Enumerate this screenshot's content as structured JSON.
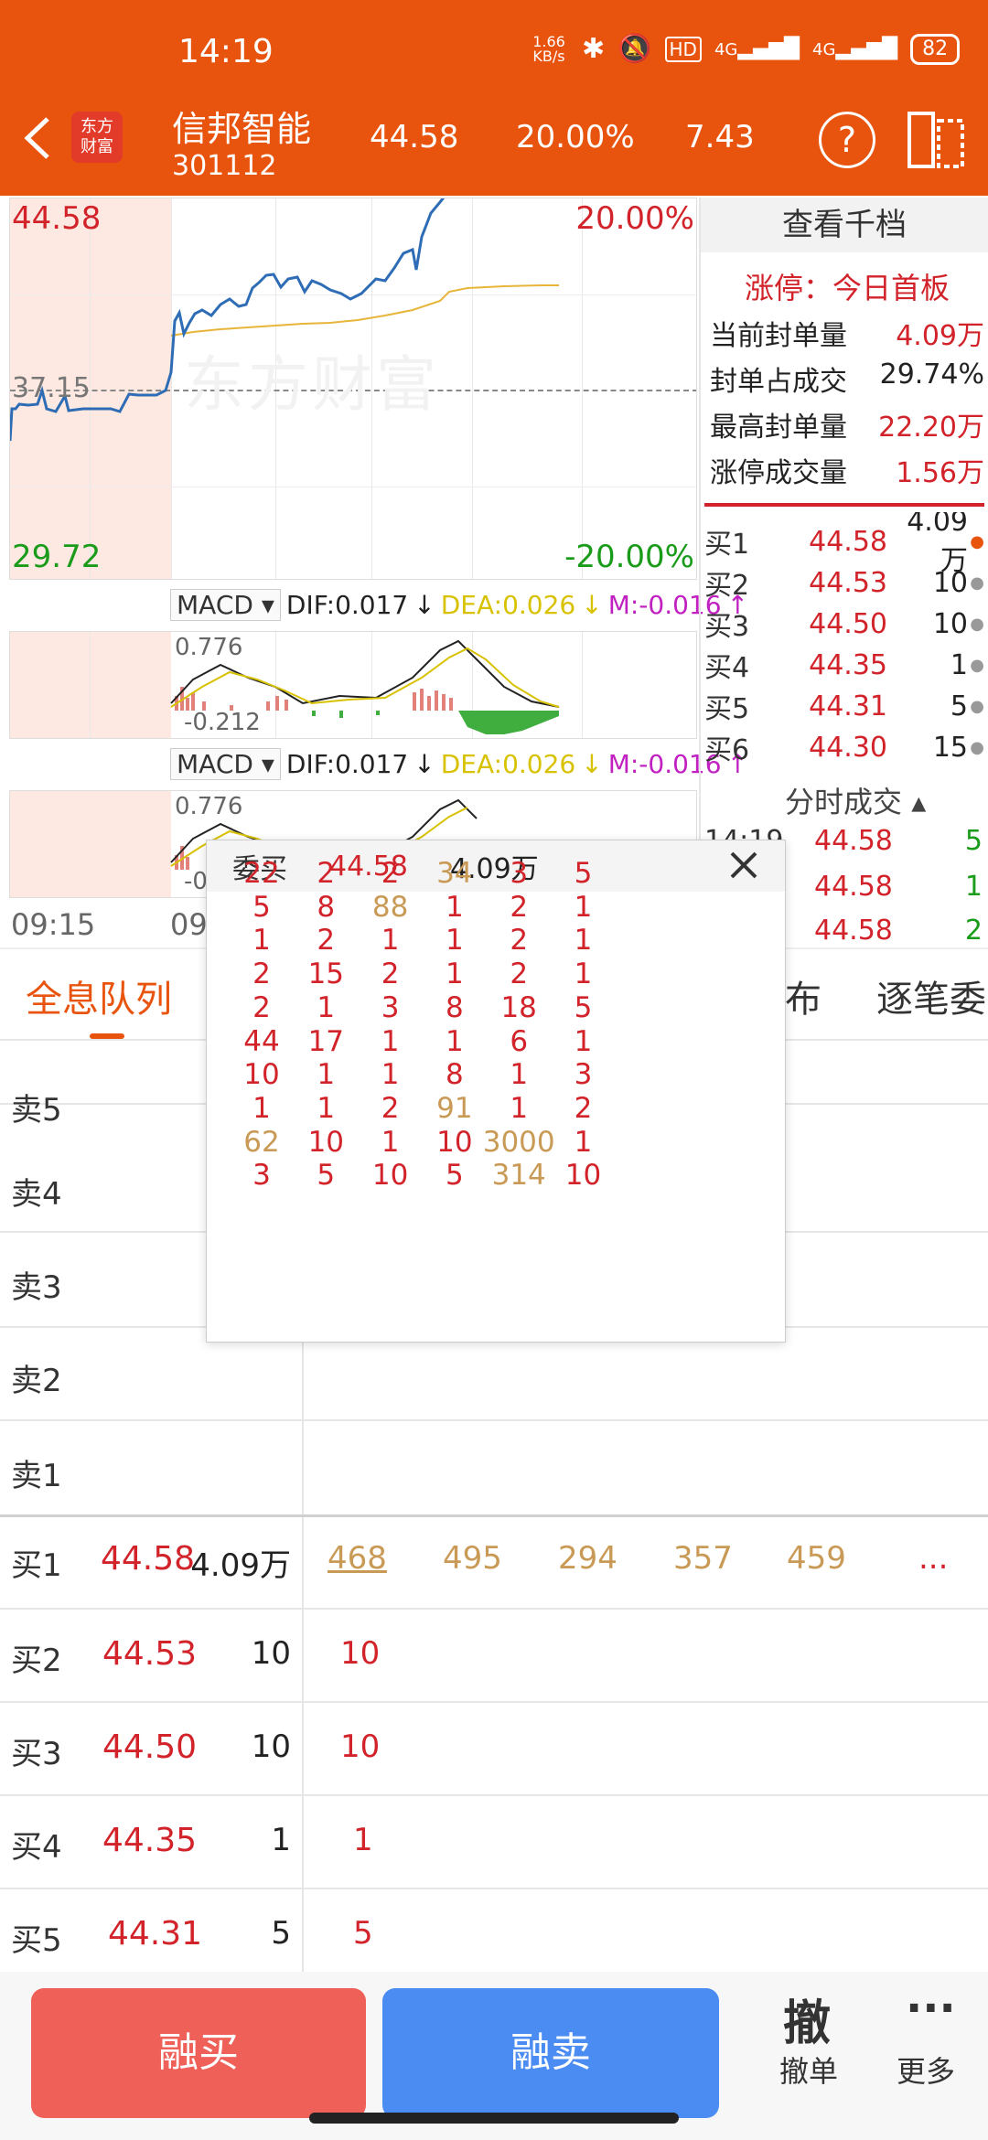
{
  "status": {
    "time": "14:19",
    "net_speed": "1.66 KB/s",
    "hd": "HD",
    "sig1": "4G",
    "sig2": "4G",
    "battery": "82"
  },
  "header": {
    "logo_text": "东方财富",
    "name": "信邦智能",
    "code": "301112",
    "price": "44.58",
    "pct": "20.00%",
    "amount": "7.43"
  },
  "chart": {
    "high_price": "44.58",
    "high_pct": "20.00%",
    "low_price": "29.72",
    "low_pct": "-20.00%",
    "base_price": "37.15",
    "time_start": "09:15",
    "time_mid": "09",
    "watermark": "东方财富",
    "colors": {
      "price_line": "#2E6DB5",
      "avg_line": "#E7B53A",
      "up": "#D2232A",
      "down": "#1A9B1A"
    }
  },
  "macd": [
    {
      "name": "MACD",
      "dif": "DIF:0.017",
      "dea": "DEA:0.026",
      "m": "M:-0.016",
      "top": "0.776",
      "bottom": "-0.212"
    },
    {
      "name": "MACD",
      "dif": "DIF:0.017",
      "dea": "DEA:0.026",
      "m": "M:-0.016",
      "top": "0.776",
      "bottom": "-0"
    }
  ],
  "right_panel": {
    "title": "查看千档",
    "limit_status": "涨停：今日首板",
    "stats": [
      {
        "label": "当前封单量",
        "value": "4.09万"
      },
      {
        "label": "封单占成交",
        "value": "29.74%"
      },
      {
        "label": "最高封单量",
        "value": "22.20万"
      },
      {
        "label": "涨停成交量",
        "value": "1.56万"
      }
    ],
    "orderbook": [
      {
        "label": "买1",
        "price": "44.58",
        "vol": "4.09万"
      },
      {
        "label": "买2",
        "price": "44.53",
        "vol": "10"
      },
      {
        "label": "买3",
        "price": "44.50",
        "vol": "10"
      },
      {
        "label": "买4",
        "price": "44.35",
        "vol": "1"
      },
      {
        "label": "买5",
        "price": "44.31",
        "vol": "5"
      },
      {
        "label": "买6",
        "price": "44.30",
        "vol": "15"
      }
    ],
    "trades_title": "分时成交",
    "trades": [
      {
        "time": "14:19",
        "price": "44.58",
        "vol": "5"
      },
      {
        "time": "",
        "price": "44.58",
        "vol": "1"
      },
      {
        "time": "",
        "price": "44.58",
        "vol": "2"
      }
    ]
  },
  "popup": {
    "label": "委买",
    "price": "44.58",
    "vol": "4.09万",
    "rows": [
      [
        "22",
        "2",
        "2",
        "34",
        "3",
        "5"
      ],
      [
        "5",
        "8",
        "88",
        "1",
        "2",
        "1"
      ],
      [
        "1",
        "2",
        "1",
        "1",
        "2",
        "1"
      ],
      [
        "2",
        "15",
        "2",
        "1",
        "2",
        "1"
      ],
      [
        "2",
        "1",
        "3",
        "8",
        "18",
        "5"
      ],
      [
        "44",
        "17",
        "1",
        "1",
        "6",
        "1"
      ],
      [
        "10",
        "1",
        "1",
        "8",
        "1",
        "3"
      ],
      [
        "1",
        "1",
        "2",
        "91",
        "1",
        "2"
      ],
      [
        "62",
        "10",
        "1",
        "10",
        "3000",
        "1"
      ],
      [
        "3",
        "5",
        "10",
        "5",
        "314",
        "10"
      ]
    ]
  },
  "tabs": {
    "active": "全息队列",
    "t2": "布",
    "t3": "逐笔委"
  },
  "sell_levels": [
    "卖5",
    "卖4",
    "卖3",
    "卖2",
    "卖1"
  ],
  "buy_levels": [
    {
      "label": "买1",
      "price": "44.58",
      "vol": "4.09万",
      "queue": [
        "468",
        "495",
        "294",
        "357",
        "459",
        "..."
      ]
    },
    {
      "label": "买2",
      "price": "44.53",
      "vol": "10",
      "queue": [
        "10"
      ]
    },
    {
      "label": "买3",
      "price": "44.50",
      "vol": "10",
      "queue": [
        "10"
      ]
    },
    {
      "label": "买4",
      "price": "44.35",
      "vol": "1",
      "queue": [
        "1"
      ]
    },
    {
      "label": "买5",
      "price": "44.31",
      "vol": "5",
      "queue": [
        "5"
      ]
    }
  ],
  "bottom": {
    "buy": "融买",
    "sell": "融卖",
    "cancel_icon": "撤",
    "cancel": "撤单",
    "more_icon": "···",
    "more": "更多"
  }
}
